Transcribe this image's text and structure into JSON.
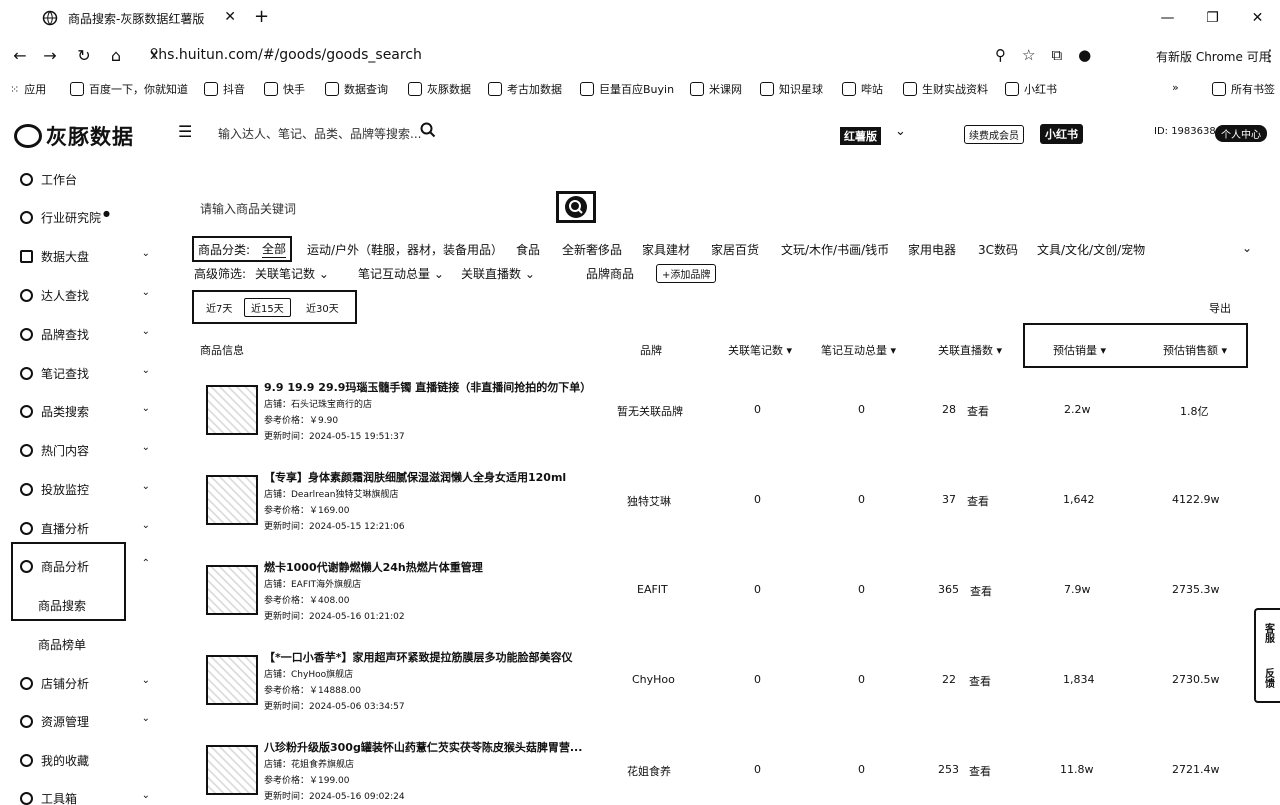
{
  "browser": {
    "tab_title": "商品搜索-灰豚数据红薯版",
    "url": "xhs.huitun.com/#/goods/goods_search",
    "update_text": "有新版 Chrome 可用",
    "bookmarks": [
      "应用",
      "百度一下，你就知道",
      "抖音",
      "快手",
      "数据查询",
      "灰豚数据",
      "考古加数据",
      "巨量百应Buyin",
      "米课网",
      "知识星球",
      "哔站",
      "生财实战资料",
      "小红书",
      "所有书签"
    ]
  },
  "header": {
    "logo_text": "灰豚数据",
    "search_placeholder": "输入达人、笔记、品类、品牌等搜索...",
    "edition": "红薯版",
    "renew": "续费成会员",
    "xhs_button": "小红书",
    "user_id": "ID: 1983638",
    "personal_center": "个人中心"
  },
  "sidebar": {
    "items": [
      {
        "label": "工作台"
      },
      {
        "label": "行业研究院"
      },
      {
        "label": "数据大盘"
      },
      {
        "label": "达人查找"
      },
      {
        "label": "品牌查找"
      },
      {
        "label": "笔记查找"
      },
      {
        "label": "品类搜索"
      },
      {
        "label": "热门内容"
      },
      {
        "label": "投放监控"
      },
      {
        "label": "直播分析"
      },
      {
        "label": "商品分析"
      },
      {
        "label": "店铺分析"
      },
      {
        "label": "资源管理"
      },
      {
        "label": "我的收藏"
      },
      {
        "label": "工具箱"
      }
    ],
    "sub_goods_search": "商品搜索",
    "sub_goods_rank": "商品榜单"
  },
  "search": {
    "placeholder": "请输入商品关键词"
  },
  "categories": {
    "label": "商品分类:",
    "all": "全部",
    "items": [
      "运动/户外（鞋服，器材，装备用品）",
      "食品",
      "全新奢侈品",
      "家具建材",
      "家居百货",
      "文玩/木作/书画/钱币",
      "家用电器",
      "3C数码",
      "文具/文化/文创/宠物"
    ]
  },
  "filters": {
    "label": "高级筛选:",
    "notes": "关联笔记数",
    "interaction": "笔记互动总量",
    "live": "关联直播数",
    "brand": "品牌商品",
    "add_brand": "+添加品牌"
  },
  "ranges": [
    "近7天",
    "近15天",
    "近30天"
  ],
  "export": "导出",
  "columns": {
    "info": "商品信息",
    "brand": "品牌",
    "notes": "关联笔记数",
    "interaction": "笔记互动总量",
    "live": "关联直播数",
    "sales": "预估销量",
    "gmv": "预估销售额"
  },
  "rows": [
    {
      "title": "9.9 19.9 29.9玛瑙玉髓手镯 直播链接（非直播间抢拍的勿下单）",
      "shop": "店铺：石头记珠宝商行的店",
      "price": "参考价格：￥9.90",
      "updated": "更新时间：2024-05-15 19:51:37",
      "brand": "暂无关联品牌",
      "notes": "0",
      "interaction": "0",
      "live": "28",
      "see": "查看",
      "sales": "2.2w",
      "gmv": "1.8亿"
    },
    {
      "title": "【专享】身体素颜霜润肤细腻保湿滋润懒人全身女适用120ml",
      "shop": "店铺：Dearlrean独特艾琳旗舰店",
      "price": "参考价格：￥169.00",
      "updated": "更新时间：2024-05-15 12:21:06",
      "brand": "独特艾琳",
      "notes": "0",
      "interaction": "0",
      "live": "37",
      "see": "查看",
      "sales": "1,642",
      "gmv": "4122.9w"
    },
    {
      "title": "燃卡1000代谢静燃懒人24h热燃片体重管理",
      "shop": "店铺：EAFIT海外旗舰店",
      "price": "参考价格：￥408.00",
      "updated": "更新时间：2024-05-16 01:21:02",
      "brand": "EAFIT",
      "notes": "0",
      "interaction": "0",
      "live": "365",
      "see": "查看",
      "sales": "7.9w",
      "gmv": "2735.3w"
    },
    {
      "title": "【*一口小香芋*】家用超声环紧致提拉筋膜层多功能脸部美容仪",
      "shop": "店铺：ChyHoo旗舰店",
      "price": "参考价格：￥14888.00",
      "updated": "更新时间：2024-05-06 03:34:57",
      "brand": "ChyHoo",
      "notes": "0",
      "interaction": "0",
      "live": "22",
      "see": "查看",
      "sales": "1,834",
      "gmv": "2730.5w"
    },
    {
      "title": "八珍粉升级版300g罐装怀山药薏仁芡实茯苓陈皮猴头菇脾胃营...",
      "shop": "店铺：花姐食养旗舰店",
      "price": "参考价格：￥199.00",
      "updated": "更新时间：2024-05-16 09:02:24",
      "brand": "花姐食养",
      "notes": "0",
      "interaction": "0",
      "live": "253",
      "see": "查看",
      "sales": "11.8w",
      "gmv": "2721.4w"
    }
  ],
  "float_tools": [
    "客服",
    "反馈"
  ]
}
